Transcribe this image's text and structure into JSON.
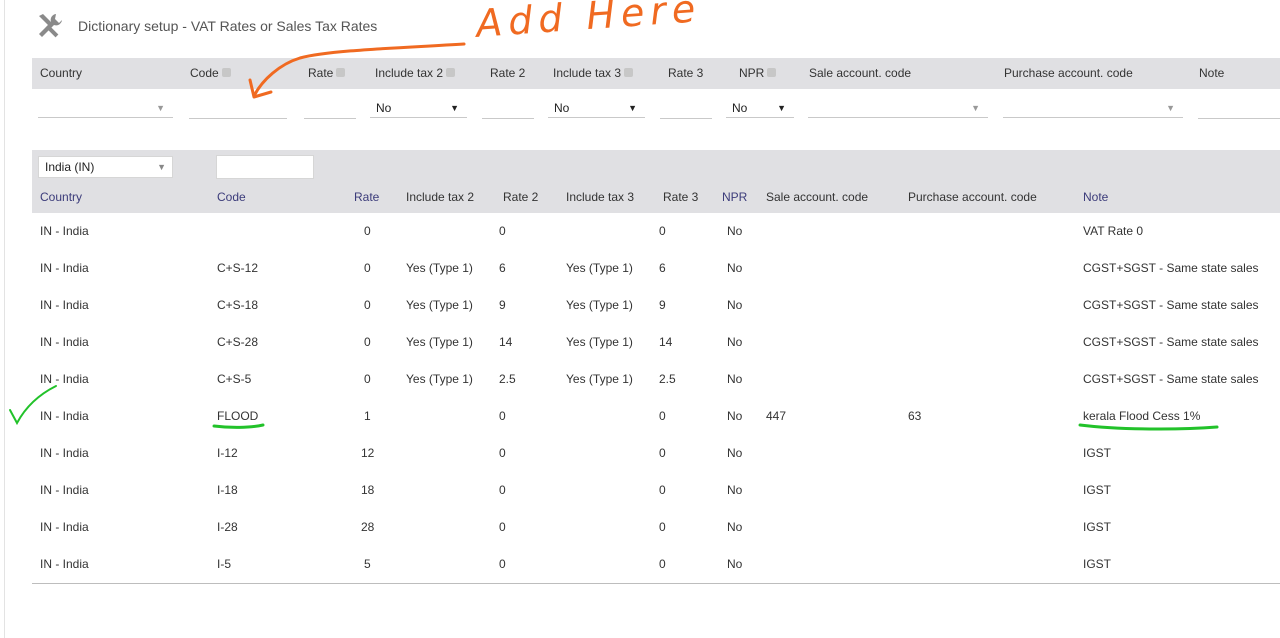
{
  "title": "Dictionary setup - VAT Rates or Sales Tax Rates",
  "annotation_text": "Add Here",
  "add_form": {
    "headers": {
      "country": "Country",
      "code": "Code",
      "rate": "Rate",
      "include_tax2": "Include tax 2",
      "rate2": "Rate 2",
      "include_tax3": "Include tax 3",
      "rate3": "Rate 3",
      "npr": "NPR",
      "sale_account": "Sale account. code",
      "purchase_account": "Purchase account. code",
      "note": "Note"
    },
    "values": {
      "country": "",
      "code": "",
      "rate": "",
      "include_tax2": "No",
      "rate2": "",
      "include_tax3": "No",
      "rate3": "",
      "npr": "No",
      "sale_account": "",
      "purchase_account": "",
      "note": ""
    }
  },
  "filter": {
    "country": "India (IN)",
    "code": ""
  },
  "list": {
    "headers": {
      "country": "Country",
      "code": "Code",
      "rate": "Rate",
      "include_tax2": "Include tax 2",
      "rate2": "Rate 2",
      "include_tax3": "Include tax 3",
      "rate3": "Rate 3",
      "npr": "NPR",
      "sale_account": "Sale account. code",
      "purchase_account": "Purchase account. code",
      "note": "Note"
    },
    "rows": [
      {
        "country": "IN - India",
        "code": "",
        "rate": "0",
        "include_tax2": "",
        "rate2": "0",
        "include_tax3": "",
        "rate3": "0",
        "npr": "No",
        "sale_account": "",
        "purchase_account": "",
        "note": "VAT Rate 0"
      },
      {
        "country": "IN - India",
        "code": "C+S-12",
        "rate": "0",
        "include_tax2": "Yes (Type 1)",
        "rate2": "6",
        "include_tax3": "Yes (Type 1)",
        "rate3": "6",
        "npr": "No",
        "sale_account": "",
        "purchase_account": "",
        "note": "CGST+SGST - Same state sales"
      },
      {
        "country": "IN - India",
        "code": "C+S-18",
        "rate": "0",
        "include_tax2": "Yes (Type 1)",
        "rate2": "9",
        "include_tax3": "Yes (Type 1)",
        "rate3": "9",
        "npr": "No",
        "sale_account": "",
        "purchase_account": "",
        "note": "CGST+SGST - Same state sales"
      },
      {
        "country": "IN - India",
        "code": "C+S-28",
        "rate": "0",
        "include_tax2": "Yes (Type 1)",
        "rate2": "14",
        "include_tax3": "Yes (Type 1)",
        "rate3": "14",
        "npr": "No",
        "sale_account": "",
        "purchase_account": "",
        "note": "CGST+SGST - Same state sales"
      },
      {
        "country": "IN - India",
        "code": "C+S-5",
        "rate": "0",
        "include_tax2": "Yes (Type 1)",
        "rate2": "2.5",
        "include_tax3": "Yes (Type 1)",
        "rate3": "2.5",
        "npr": "No",
        "sale_account": "",
        "purchase_account": "",
        "note": "CGST+SGST - Same state sales"
      },
      {
        "country": "IN - India",
        "code": "FLOOD",
        "rate": "1",
        "include_tax2": "",
        "rate2": "0",
        "include_tax3": "",
        "rate3": "0",
        "npr": "No",
        "sale_account": "447",
        "purchase_account": "63",
        "note": "kerala Flood Cess 1%"
      },
      {
        "country": "IN - India",
        "code": "I-12",
        "rate": "12",
        "include_tax2": "",
        "rate2": "0",
        "include_tax3": "",
        "rate3": "0",
        "npr": "No",
        "sale_account": "",
        "purchase_account": "",
        "note": "IGST"
      },
      {
        "country": "IN - India",
        "code": "I-18",
        "rate": "18",
        "include_tax2": "",
        "rate2": "0",
        "include_tax3": "",
        "rate3": "0",
        "npr": "No",
        "sale_account": "",
        "purchase_account": "",
        "note": "IGST"
      },
      {
        "country": "IN - India",
        "code": "I-28",
        "rate": "28",
        "include_tax2": "",
        "rate2": "0",
        "include_tax3": "",
        "rate3": "0",
        "npr": "No",
        "sale_account": "",
        "purchase_account": "",
        "note": "IGST"
      },
      {
        "country": "IN - India",
        "code": "I-5",
        "rate": "5",
        "include_tax2": "",
        "rate2": "0",
        "include_tax3": "",
        "rate3": "0",
        "npr": "No",
        "sale_account": "",
        "purchase_account": "",
        "note": "IGST"
      }
    ]
  },
  "colors": {
    "header_bg": "#e0e0e3",
    "link_text": "#3b3b7a",
    "annotation_orange": "#f06a21",
    "annotation_green": "#22c22a"
  },
  "icons": {
    "title": "tools-icon",
    "dropdown": "caret-down-icon",
    "help": "help-icon"
  }
}
